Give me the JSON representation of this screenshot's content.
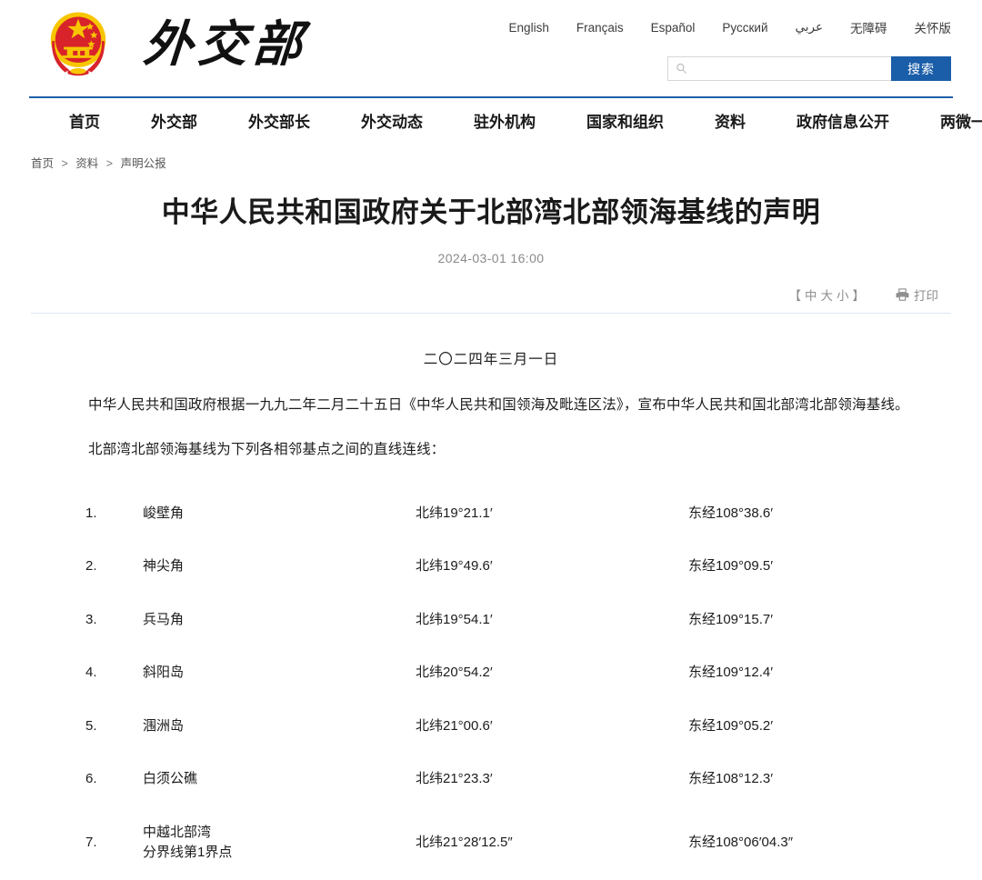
{
  "site": {
    "emblem_alt": "china-national-emblem",
    "logo_text": "外交部"
  },
  "lang_bar": [
    {
      "label": "English"
    },
    {
      "label": "Français"
    },
    {
      "label": "Español"
    },
    {
      "label": "Русский"
    },
    {
      "label": "عربي"
    },
    {
      "label": "无障碍"
    },
    {
      "label": "关怀版"
    }
  ],
  "search": {
    "value": "",
    "placeholder": "",
    "button_label": "搜索",
    "icon": "search-icon"
  },
  "nav": [
    {
      "label": "首页"
    },
    {
      "label": "外交部"
    },
    {
      "label": "外交部长"
    },
    {
      "label": "外交动态"
    },
    {
      "label": "驻外机构"
    },
    {
      "label": "国家和组织"
    },
    {
      "label": "资料"
    },
    {
      "label": "政府信息公开"
    },
    {
      "label": "两微一端"
    }
  ],
  "breadcrumb": {
    "items": [
      {
        "label": "首页"
      },
      {
        "label": "资料"
      },
      {
        "label": "声明公报"
      }
    ],
    "separator": ">"
  },
  "article": {
    "title": "中华人民共和国政府关于北部湾北部领海基线的声明",
    "date": "2024-03-01 16:00",
    "toolbar": {
      "bracket_open": "【",
      "bracket_close": "】",
      "size_medium": "中",
      "size_large": "大",
      "size_small": "小",
      "print_label": "打印",
      "print_icon": "printer-icon"
    },
    "doc_date": "二〇二四年三月一日",
    "paragraphs": [
      "中华人民共和国政府根据一九九二年二月二十五日《中华人民共和国领海及毗连区法》，宣布中华人民共和国北部湾北部领海基线。",
      "北部湾北部领海基线为下列各相邻基点之间的直线连线："
    ],
    "basepoints": [
      {
        "index": "1.",
        "name": "峻壁角",
        "name2": "",
        "lat": "北纬19°21.1′",
        "lon": "东经108°38.6′"
      },
      {
        "index": "2.",
        "name": "神尖角",
        "name2": "",
        "lat": "北纬19°49.6′",
        "lon": "东经109°09.5′"
      },
      {
        "index": "3.",
        "name": "兵马角",
        "name2": "",
        "lat": "北纬19°54.1′",
        "lon": "东经109°15.7′"
      },
      {
        "index": "4.",
        "name": "斜阳岛",
        "name2": "",
        "lat": "北纬20°54.2′",
        "lon": "东经109°12.4′"
      },
      {
        "index": "5.",
        "name": "涠洲岛",
        "name2": "",
        "lat": "北纬21°00.6′",
        "lon": "东经109°05.2′"
      },
      {
        "index": "6.",
        "name": "白须公礁",
        "name2": "",
        "lat": "北纬21°23.3′",
        "lon": "东经108°12.3′"
      },
      {
        "index": "7.",
        "name": "中越北部湾",
        "name2": "分界线第1界点",
        "lat": "北纬21°28′12.5″",
        "lon": "东经108°06′04.3″"
      }
    ]
  },
  "colors": {
    "accent_blue": "#1a5da9",
    "nav_border": "#1e5fa8",
    "divider": "#dce9f6",
    "emblem_red": "#d8232a",
    "emblem_gold": "#f5c518"
  }
}
